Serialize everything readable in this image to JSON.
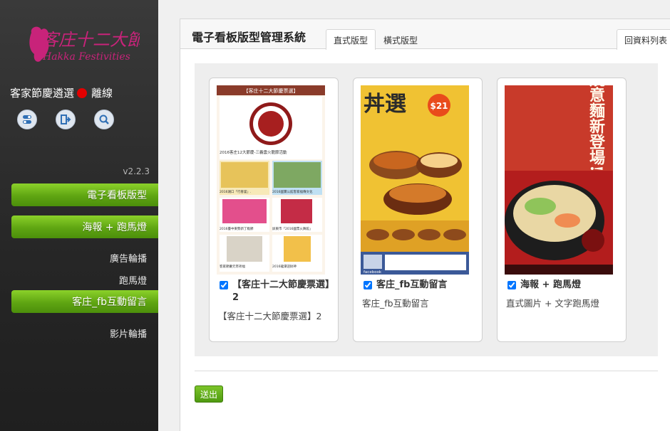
{
  "logo": {
    "cn_text": "客庄十二大節慶",
    "en_text": "Hakka Festivities"
  },
  "status": {
    "label": "客家節慶遴選",
    "state": "離線",
    "dot_color": "#e30000"
  },
  "icons": [
    "toggle-icon",
    "logout-icon",
    "search-icon"
  ],
  "version": "v2.2.3",
  "nav": {
    "signage_layout": "電子看板版型",
    "poster_marquee": "海報 + 跑馬燈",
    "ad_carousel": "廣告輪播",
    "marquee": "跑馬燈",
    "fb_message": "客庄_fb互動留言",
    "video_carousel": "影片輪播"
  },
  "header": {
    "title": "電子看板版型管理系統",
    "tabs": [
      "直式版型",
      "橫式版型"
    ],
    "back_label": "回資料列表"
  },
  "cards": [
    {
      "title": "【客庄十二大節慶票選】2",
      "desc": "【客庄十二大節慶票選】2",
      "checked": true
    },
    {
      "title": "客庄_fb互動留言",
      "desc": "客庄_fb互動留言",
      "checked": true
    },
    {
      "title": "海報 + 跑馬燈",
      "desc": "直式圖片 + 文字跑馬燈",
      "checked": true
    }
  ],
  "thumb1": {
    "header": "【客庄十二大節慶票選】",
    "caption1": "2016客庄12大節慶-三義雲火龍節活動",
    "caption2a": "2016湖口「行春宴」.",
    "caption2b": "2016國寶公館客家福傳文化",
    "caption3a": "2016臺中東勢新丁粄節",
    "caption3b": "屏東市「2016國票火舞館」",
    "caption4a": "客家節慶元宵祈福",
    "caption4b": "2016龍潭迎財神"
  },
  "thumb2": {
    "title_char": "丼選",
    "price": "$21",
    "footer": "facebook"
  },
  "thumb3": {
    "headline": "鍋燒意麵新登場!"
  },
  "submit_label": "送出"
}
